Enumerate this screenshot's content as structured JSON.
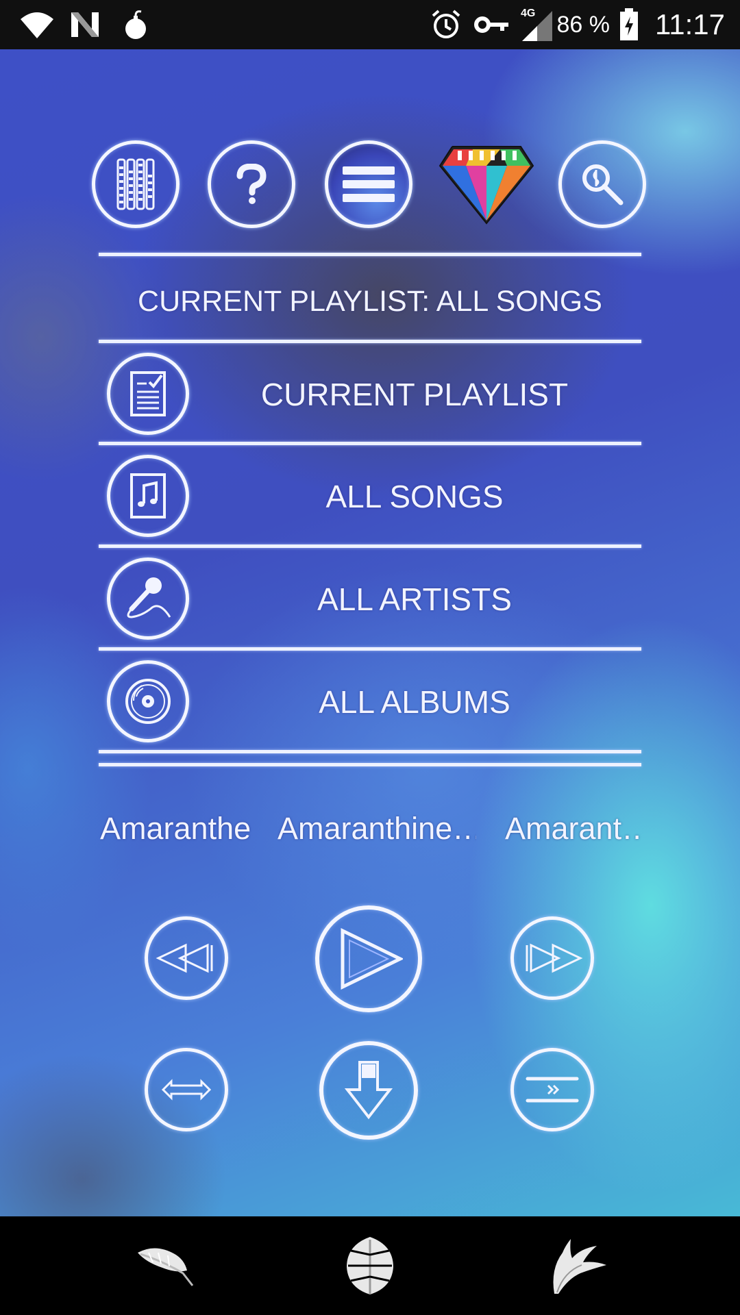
{
  "status_bar": {
    "left_icons": [
      "wifi-icon",
      "n-icon",
      "bomb-icon"
    ],
    "right_icons": [
      "alarm-icon",
      "vpn-key-icon",
      "signal-4g-icon",
      "battery-charging-icon"
    ],
    "network": "4G",
    "battery": "86 %",
    "time": "11:17"
  },
  "toolbar": {
    "buttons": [
      "equalizer-icon",
      "help-icon",
      "menu-icon",
      "diamond-logo",
      "search-music-icon"
    ]
  },
  "playlist": {
    "title": "CURRENT PLAYLIST: ALL SONGS"
  },
  "menu": {
    "items": [
      {
        "label": "CURRENT PLAYLIST",
        "icon": "checklist-icon"
      },
      {
        "label": "ALL SONGS",
        "icon": "music-note-icon"
      },
      {
        "label": "ALL ARTISTS",
        "icon": "microphone-icon"
      },
      {
        "label": "ALL ALBUMS",
        "icon": "vinyl-disc-icon"
      }
    ]
  },
  "now_playing": {
    "artist": "Amaranthe",
    "album": "Amaranthine…",
    "title": "Amarant…"
  },
  "controls": {
    "row1": [
      "rewind-icon",
      "play-icon",
      "fast-forward-icon"
    ],
    "row2": [
      "repeat-icon",
      "download-icon",
      "queue-icon"
    ]
  },
  "nav_bar": {
    "buttons": [
      "feather-leaf-icon",
      "monstera-leaf-icon",
      "palm-leaf-icon"
    ]
  },
  "colors": {
    "accent": "#f2f4ff",
    "background_blue": "#3f52c4",
    "background_cyan": "#5fdcdc"
  }
}
